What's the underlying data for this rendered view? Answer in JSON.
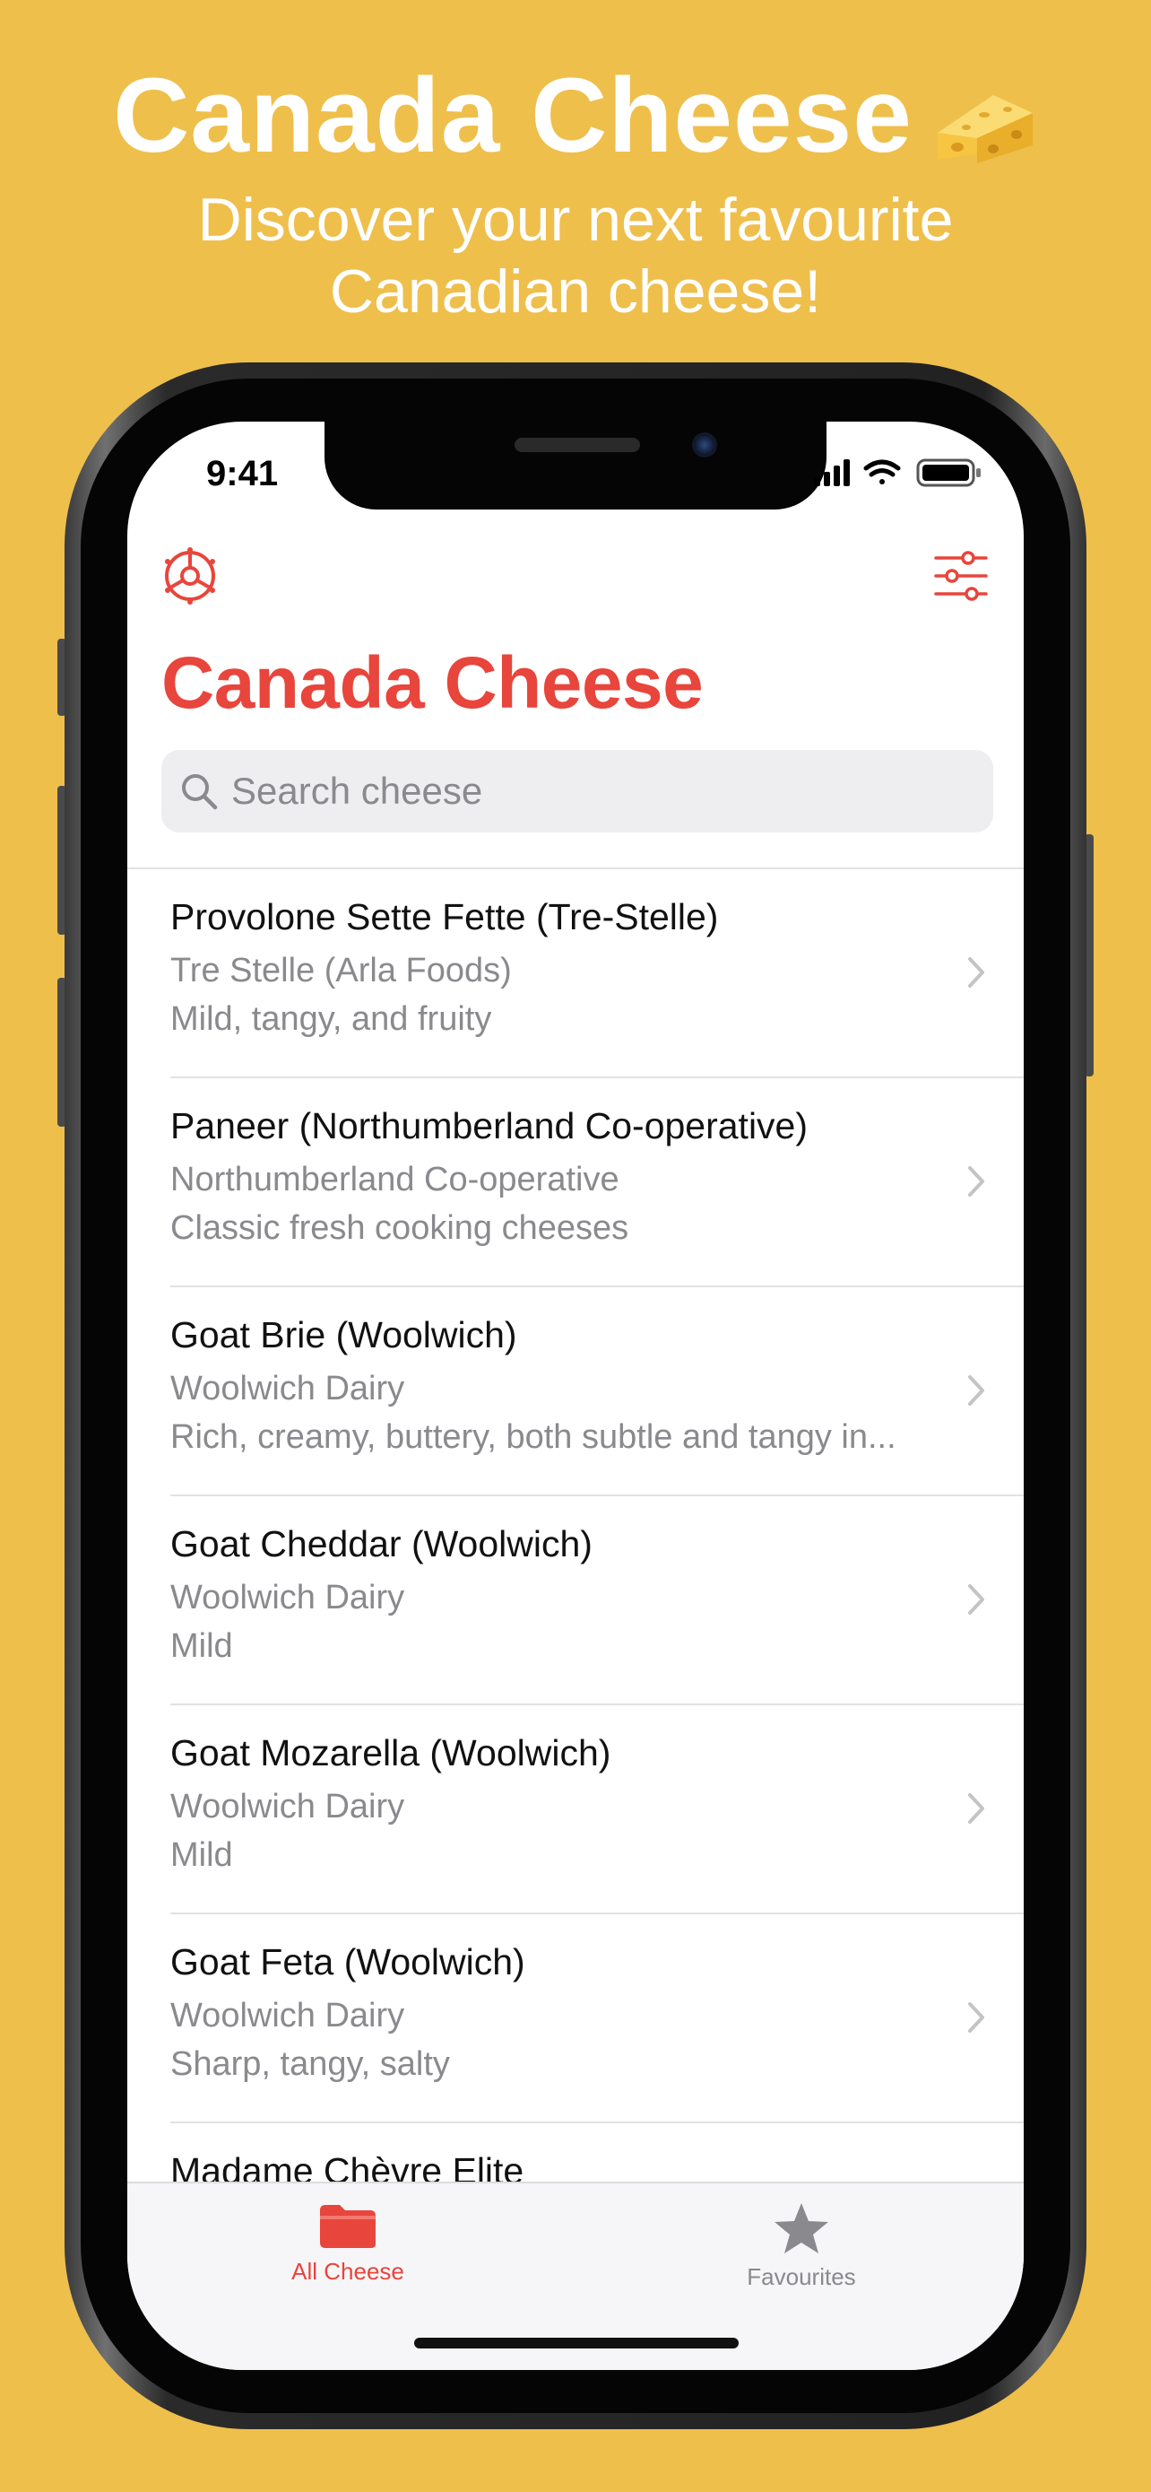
{
  "promo": {
    "title": "Canada Cheese",
    "title_emoji_icon": "cheese-wedge-icon",
    "subtitle_line1": "Discover your next favourite",
    "subtitle_line2": "Canadian cheese!",
    "background_color": "#EFBF4C"
  },
  "status_bar": {
    "time": "9:41",
    "icons": [
      "cellular-signal-icon",
      "wifi-icon",
      "battery-icon"
    ]
  },
  "nav": {
    "left_icon": "settings-wheel-icon",
    "right_icon": "filter-sliders-icon",
    "title": "Canada Cheese",
    "accent_color": "#E8453C"
  },
  "search": {
    "placeholder": "Search cheese"
  },
  "cheeses": [
    {
      "name": "Provolone Sette Fette (Tre-Stelle)",
      "maker": "Tre Stelle (Arla Foods)",
      "description": "Mild, tangy, and fruity"
    },
    {
      "name": "Paneer (Northumberland Co-operative)",
      "maker": "Northumberland Co-operative",
      "description": "Classic fresh cooking cheeses"
    },
    {
      "name": "Goat Brie (Woolwich)",
      "maker": "Woolwich Dairy",
      "description": "Rich, creamy, buttery, both subtle and tangy in..."
    },
    {
      "name": "Goat Cheddar (Woolwich)",
      "maker": "Woolwich Dairy",
      "description": "Mild"
    },
    {
      "name": "Goat Mozarella (Woolwich)",
      "maker": "Woolwich Dairy",
      "description": "Mild"
    },
    {
      "name": "Goat Feta (Woolwich)",
      "maker": "Woolwich Dairy",
      "description": "Sharp, tangy, salty"
    },
    {
      "name": "Madame Chèvre Elite",
      "maker": "",
      "description": ""
    }
  ],
  "tab_bar": {
    "tabs": [
      {
        "label": "All Cheese",
        "icon": "folder-icon",
        "selected": true
      },
      {
        "label": "Favourites",
        "icon": "star-icon",
        "selected": false
      }
    ]
  }
}
